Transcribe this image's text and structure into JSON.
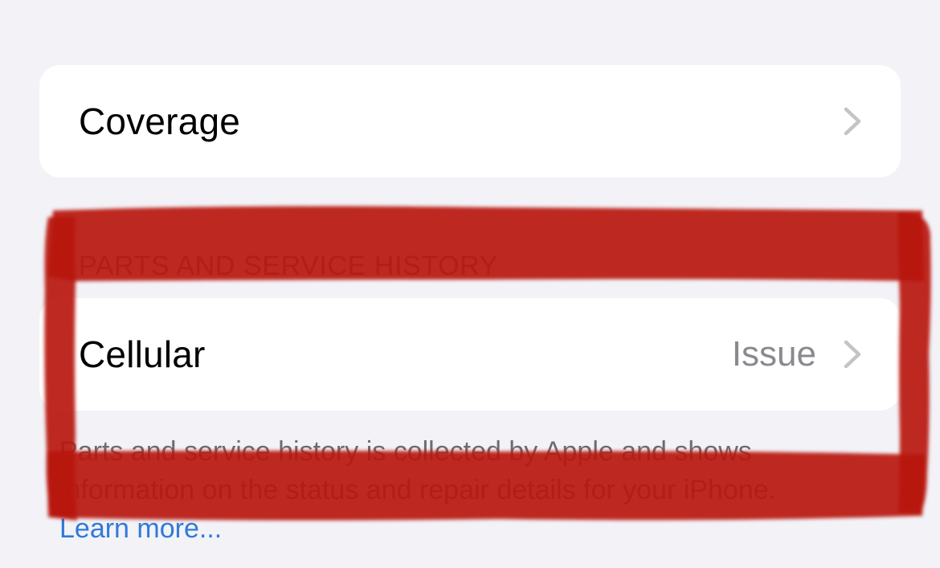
{
  "coverage_row": {
    "label": "Coverage"
  },
  "parts_section": {
    "header": "PARTS AND SERVICE HISTORY",
    "rows": [
      {
        "label": "Cellular",
        "value": "Issue"
      }
    ],
    "footer": "Parts and service history is collected by Apple and shows information on the status and repair details for your iPhone.",
    "learn_more": "Learn more..."
  },
  "icons": {
    "chevron": "chevron-right-icon"
  },
  "colors": {
    "background": "#f2f2f7",
    "card": "#ffffff",
    "secondary_text": "#8a8a8e",
    "link": "#2f7ad8",
    "highlight_marker": "#b8190c"
  }
}
